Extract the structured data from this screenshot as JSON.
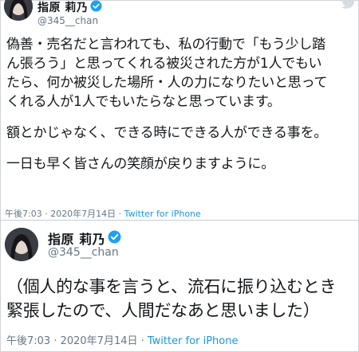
{
  "colors": {
    "text": "#14171a",
    "muted": "#657786",
    "link": "#1b95e0",
    "verified": "#1da1f2"
  },
  "tweets": [
    {
      "display_name": "指原 莉乃",
      "handle": "@345__chan",
      "avatar_icon": "avatar",
      "verified_icon": "verified-badge-icon",
      "paragraphs": [
        "偽善・売名だと言われても、私の行動で「もう少し踏\nん張ろう」と思ってくれる被災された方が1人でもい\nたら、何か被災した場所・人の力になりたいと思って\nくれる人が1人でもいたらなと思っています。",
        "額とかじゃなく、できる時にできる人ができる事を。",
        "一日も早く皆さんの笑顔が戻りますように。"
      ],
      "time": "午後7:03 · 2020年7月14日 · ",
      "source": "Twitter for iPhone"
    },
    {
      "display_name": "指原 莉乃",
      "handle": "@345__chan",
      "avatar_icon": "avatar",
      "verified_icon": "verified-badge-icon",
      "text": "（個人的な事を言うと、流石に振り込むとき\n緊張したので、人間だなあと思いました）",
      "time": "午後7:03 · 2020年7月14日 · ",
      "source": "Twitter for iPhone"
    }
  ]
}
